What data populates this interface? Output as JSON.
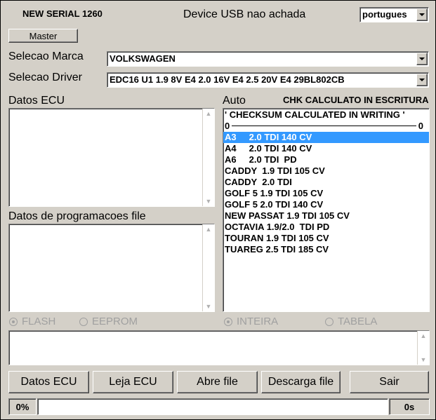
{
  "header": {
    "serial": "NEW SERIAL 1260",
    "status": "Device USB nao achada",
    "language": "portugues"
  },
  "master_button": "Master",
  "marca": {
    "label": "Selecao Marca",
    "value": "VOLKSWAGEN"
  },
  "driver": {
    "label": "Selecao Driver",
    "value": "EDC16 U1   1.9 8V E4  2.0 16V E4  2.5 20V E4 29BL802CB"
  },
  "datos_ecu_label": "Datos ECU",
  "datos_prog_label": "Datos de programacoes file",
  "auto_label": "Auto",
  "chk_label": "CHK CALCULATO IN ESCRITURA",
  "auto_list": {
    "header": "' CHECKSUM CALCULATED IN WRITING '",
    "range_min": "0",
    "range_max": "0",
    "items": [
      "A3     2.0 TDI 140 CV",
      "A4     2.0 TDI 140 CV",
      "A6     2.0 TDI  PD",
      "CADDY  1.9 TDI 105 CV",
      "CADDY  2.0 TDI",
      "GOLF 5 1.9 TDI 105 CV",
      "GOLF 5 2.0 TDI 140 CV",
      "NEW PASSAT 1.9 TDI 105 CV",
      "OCTAVIA 1.9/2.0  TDI PD",
      "TOURAN 1.9 TDI 105 CV",
      "TUAREG 2.5 TDI 185 CV"
    ],
    "selected_index": 0
  },
  "radios": {
    "flash": "FLASH",
    "eeprom": "EEPROM",
    "inteira": "INTEIRA",
    "tabela": "TABELA"
  },
  "buttons": {
    "datos_ecu": "Datos ECU",
    "leja_ecu": "Leja ECU",
    "abre_file": "Abre file",
    "descarga_file": "Descarga file",
    "sair": "Sair"
  },
  "progress": {
    "percent_text": "0%",
    "time_text": "0s",
    "fraction": 0
  },
  "colors": {
    "selection": "#3399ff",
    "background": "#d4d0c8"
  }
}
